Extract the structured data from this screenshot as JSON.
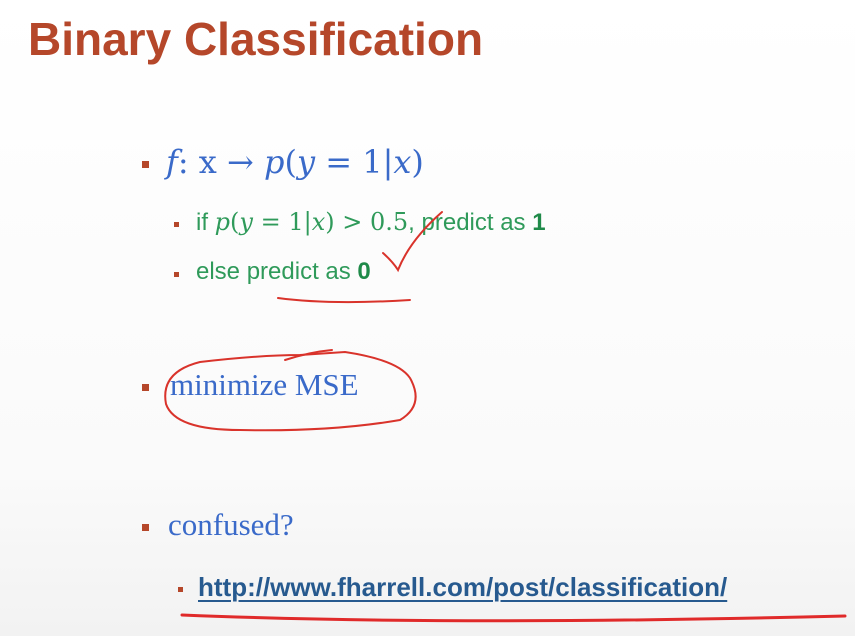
{
  "slide": {
    "title": "Binary Classification",
    "bullet_formula": {
      "f": "f",
      "colon_x": ": x",
      "arrow": " → ",
      "p": "p",
      "open": "(",
      "y": "y",
      "eq_one": " = 1",
      "bar_x": "|x",
      "close": ")"
    },
    "sub_if": {
      "if_word": "if ",
      "p": "p",
      "open": "(",
      "y": "y",
      "eq_one": " = 1|",
      "x": "x",
      "close_gt": ") > 0.5",
      "rest": ", predict as ",
      "one": "1"
    },
    "sub_else": {
      "text": "else predict as ",
      "zero": "0"
    },
    "bullet_minimize": "minimize MSE",
    "bullet_confused": "confused?",
    "link_text": "http://www.fharrell.com/post/classification/"
  },
  "colors": {
    "title": "#b5472a",
    "bullet": "#b5472a",
    "math_blue": "#3a6ac9",
    "green": "#2f9a5a",
    "link": "#275a8f",
    "ink_red": "#d9332b"
  }
}
